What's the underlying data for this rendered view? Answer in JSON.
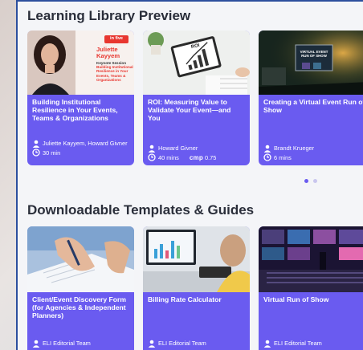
{
  "library": {
    "title": "Learning Library Preview",
    "cards": [
      {
        "thumb_lines": [
          "Juliette",
          "Kayyem",
          "Keynote Session",
          "Building Institutional",
          "Resilience in Your",
          "Events, Teams &",
          "Organizations"
        ],
        "badge": "in five",
        "title": "Building Institutional Resilience in Your Events, Teams & Organizations",
        "author": "Juliette Kayyem, Howard Givner",
        "duration": "30 min"
      },
      {
        "thumb_lines": [
          "ROI"
        ],
        "title": "ROI: Measuring Value to Validate Your Event—and You",
        "author": "Howard Givner",
        "duration": "40 mins",
        "cmp_label": "cmp",
        "cmp_value": "0.75"
      },
      {
        "thumb_lines": [
          "VIRTUAL EVENT",
          "RUN OF SHOW"
        ],
        "title": "Creating a Virtual Event Run of Show",
        "author": "Brandt Krueger",
        "duration": "6 mins"
      }
    ],
    "carousel": {
      "active_color": "#6a5bf0",
      "inactive_color": "#c9c6ee"
    }
  },
  "templates": {
    "title": "Downloadable Templates & Guides",
    "cards": [
      {
        "title": "Client/Event Discovery Form (for Agencies & Independent Planners)",
        "author": "ELI Editorial Team"
      },
      {
        "title": "Billing Rate Calculator",
        "author": "ELI Editorial Team"
      },
      {
        "title": "Virtual Run of Show",
        "author": "ELI Editorial Team"
      }
    ]
  },
  "colors": {
    "card_bg": "#6a5bf0",
    "frame_border": "#2c4f9e",
    "badge": "#e8362f"
  },
  "icons": {
    "author": "person-icon",
    "duration": "clock-icon"
  }
}
